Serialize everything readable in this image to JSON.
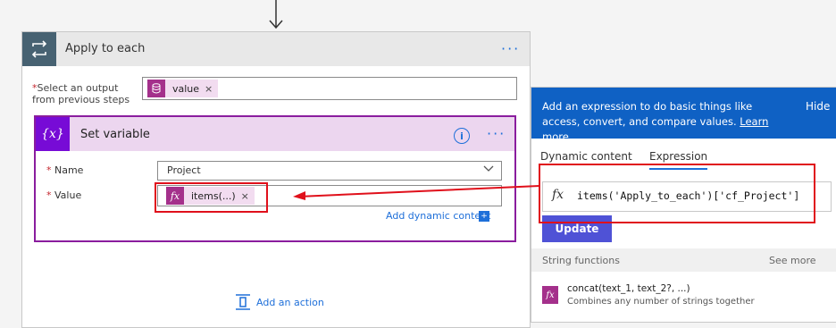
{
  "apply_each": {
    "title": "Apply to each",
    "more": "···",
    "output_label_line1": "Select an output",
    "output_label_line2": "from previous steps",
    "required_mark": "*",
    "token": {
      "label": "value",
      "remove": "×",
      "icon": "database-icon"
    }
  },
  "set_variable": {
    "title": "Set variable",
    "icon_text": "{x}",
    "info": "i",
    "more": "···",
    "name_label": "Name",
    "name_value": "Project",
    "value_label": "Value",
    "value_token": {
      "label": "items(...)",
      "remove": "×",
      "icon": "fx-icon",
      "icon_text": "fx"
    },
    "dynamic_link": "Add dynamic content",
    "dynamic_icon": "+"
  },
  "add_action": "Add an action",
  "panel": {
    "message": "Add an expression to do basic things like access, convert, and compare values.",
    "learn_more": "Learn more",
    "hide": "Hide",
    "tabs": [
      {
        "label": "Dynamic content",
        "active": false
      },
      {
        "label": "Expression",
        "active": true
      }
    ],
    "fx": "fx",
    "expression": "items('Apply_to_each')['cf_Project']",
    "update": "Update",
    "section": "String functions",
    "see_more": "See more",
    "function_name": "concat(text_1, text_2?, ...)",
    "function_desc": "Combines any number of strings together",
    "function_icon_text": "fx"
  },
  "colors": {
    "accent": "#1e6fd9",
    "variable_purple": "#770bd6",
    "token_magenta": "#a4308b",
    "panel_blue": "#0f61c4",
    "highlight_red": "#e0101b",
    "update_button": "#4f52d6"
  }
}
